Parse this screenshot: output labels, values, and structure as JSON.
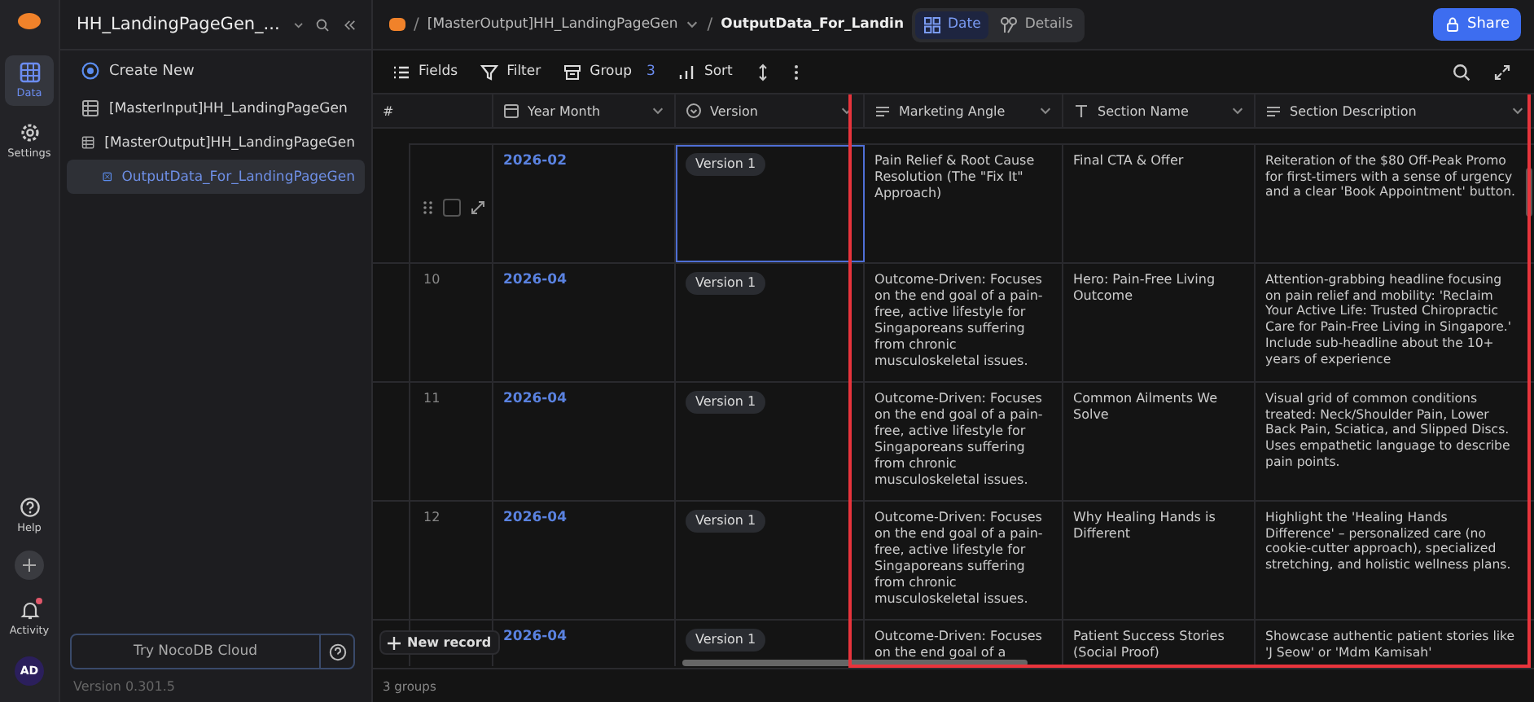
{
  "rail": {
    "items": [
      {
        "label": "Data",
        "kind": "grid",
        "selected": true
      },
      {
        "label": "Settings",
        "kind": "gear",
        "selected": false
      }
    ],
    "bottom_items": [
      {
        "label": "Help",
        "kind": "help"
      },
      {
        "label": "Activity",
        "kind": "bell",
        "notification": true
      }
    ],
    "avatar": "AD"
  },
  "sidebar": {
    "base_title": "HH_LandingPageGen_...",
    "create_new": "Create New",
    "tables": [
      {
        "label": "[MasterInput]HH_LandingPageGen",
        "selected": false
      },
      {
        "label": "[MasterOutput]HH_LandingPageGen",
        "selected": false,
        "children": [
          {
            "label": "OutputData_For_LandingPageGen",
            "selected": true
          }
        ]
      }
    ],
    "cloud_button": "Try NocoDB Cloud",
    "version": "Version 0.301.5"
  },
  "topbar": {
    "separator": "/",
    "breadcrumb": [
      "[MasterOutput]HH_LandingPageGen",
      "OutputData_For_Landin"
    ],
    "view_tabs": [
      {
        "label": "Date",
        "kind": "grid",
        "selected": true
      },
      {
        "label": "Details",
        "kind": "details",
        "selected": false
      }
    ],
    "share": "Share"
  },
  "toolbar": {
    "items": [
      {
        "label": "Fields",
        "kind": "fields"
      },
      {
        "label": "Filter",
        "kind": "filter"
      },
      {
        "label": "Group",
        "kind": "group",
        "badge": "3"
      },
      {
        "label": "Sort",
        "kind": "sort"
      }
    ]
  },
  "table": {
    "columns": [
      {
        "label": "#",
        "kind": "number"
      },
      {
        "label": "Year Month",
        "kind": "date"
      },
      {
        "label": "Version",
        "kind": "select"
      },
      {
        "label": "Marketing Angle",
        "kind": "long-text"
      },
      {
        "label": "Section Name",
        "kind": "text"
      },
      {
        "label": "Section Description",
        "kind": "long-text"
      }
    ],
    "rows": [
      {
        "focused": true,
        "year_month": "2026-02",
        "version": "Version 1",
        "marketing_angle": "Pain Relief & Root Cause Resolution (The \"Fix It\" Approach)",
        "section_name": "Final CTA & Offer",
        "section_description": "Reiteration of the $80 Off-Peak Promo for first-timers with a sense of urgency and a clear 'Book Appointment' button."
      },
      {
        "number": "10",
        "focused": false,
        "year_month": "2026-04",
        "version": "Version 1",
        "marketing_angle": "Outcome-Driven: Focuses on the end goal of a pain-free, active lifestyle for Singaporeans suffering from chronic musculoskeletal issues.",
        "section_name": "Hero: Pain-Free Living Outcome",
        "section_description": "Attention-grabbing headline focusing on pain relief and mobility: 'Reclaim Your Active Life: Trusted Chiropractic Care for Pain-Free Living in Singapore.' Include sub-headline about the 10+ years of experience"
      },
      {
        "number": "11",
        "focused": false,
        "year_month": "2026-04",
        "version": "Version 1",
        "marketing_angle": "Outcome-Driven: Focuses on the end goal of a pain-free, active lifestyle for Singaporeans suffering from chronic musculoskeletal issues.",
        "section_name": "Common Ailments We Solve",
        "section_description": "Visual grid of common conditions treated: Neck/Shoulder Pain, Lower Back Pain, Sciatica, and Slipped Discs. Uses empathetic language to describe pain points."
      },
      {
        "number": "12",
        "focused": false,
        "year_month": "2026-04",
        "version": "Version 1",
        "marketing_angle": "Outcome-Driven: Focuses on the end goal of a pain-free, active lifestyle for Singaporeans suffering from chronic musculoskeletal issues.",
        "section_name": "Why Healing Hands is Different",
        "section_description": "Highlight the 'Healing Hands Difference' – personalized care (no cookie-cutter approach), specialized stretching, and holistic wellness plans."
      },
      {
        "focused": false,
        "year_month": "2026-04",
        "version": "Version 1",
        "marketing_angle": "Outcome-Driven: Focuses on the end goal of a",
        "section_name": "Patient Success Stories (Social Proof)",
        "section_description": "Showcase authentic patient stories like 'J Seow' or 'Mdm Kamisah'"
      }
    ]
  },
  "new_record": "New record",
  "status_bar": "3 groups"
}
